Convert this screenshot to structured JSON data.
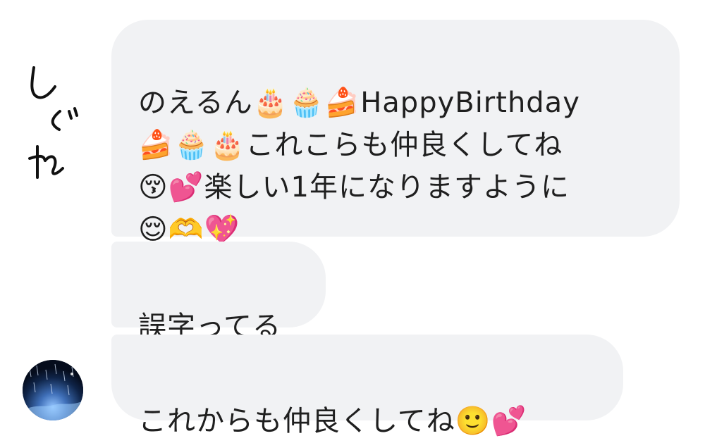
{
  "chat": {
    "messages": [
      {
        "text": "のえるん🎂🧁🍰HappyBirthday\n🍰🧁🎂これこらも仲良くしてね\n😚💕楽しい1年になりますように\n😌🫶💖"
      },
      {
        "text": "誤字ってる"
      },
      {
        "text": "これからも仲良くしてね🙂💕"
      }
    ],
    "handwritten_note": "しぐれ"
  },
  "colors": {
    "bubble_background": "#f1f2f4",
    "text": "#1f1f1f",
    "page_background": "#ffffff"
  },
  "icons": {
    "avatar": "avatar-image"
  }
}
